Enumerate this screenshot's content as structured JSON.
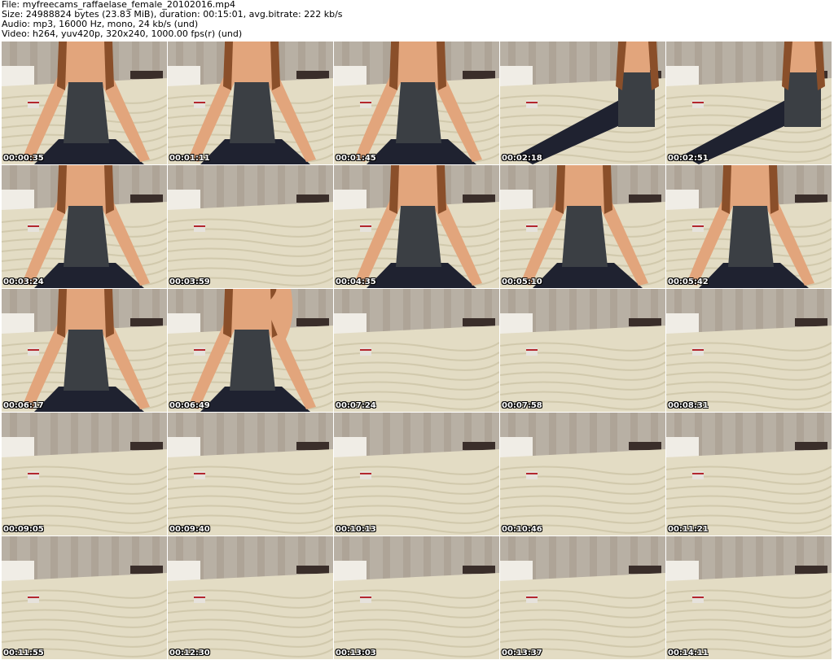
{
  "header": {
    "file_line": "File: myfreecams_raffaelase_female_20102016.mp4",
    "size_line": "Size: 24988824 bytes (23.83 MiB), duration: 00:15:01, avg.bitrate: 222 kb/s",
    "audio_line": "Audio: mp3, 16000 Hz, mono, 24 kb/s (und)",
    "video_line": "Video: h264, yuv420p, 320x240, 1000.00 fps(r) (und)"
  },
  "colors": {
    "wall": "#b8b0a4",
    "bedspread": "#e3dcc4",
    "bedspread_shadow": "#c9c0a3",
    "skin": "#e2a57c",
    "hair": "#8a4f2a",
    "top": "#3b3f44",
    "leggings": "#1f2230",
    "shelf": "#3a2e2a",
    "box": "#e6e2dc",
    "box_stripe": "#b3262e"
  },
  "thumbnails": [
    {
      "time": "00:00:35",
      "scene": "person-sitting"
    },
    {
      "time": "00:01:11",
      "scene": "person-sitting"
    },
    {
      "time": "00:01:45",
      "scene": "person-sitting"
    },
    {
      "time": "00:02:18",
      "scene": "person-reclining"
    },
    {
      "time": "00:02:51",
      "scene": "person-reclining"
    },
    {
      "time": "00:03:24",
      "scene": "person-sitting"
    },
    {
      "time": "00:03:59",
      "scene": "empty-bed"
    },
    {
      "time": "00:04:35",
      "scene": "person-sitting"
    },
    {
      "time": "00:05:10",
      "scene": "person-sitting"
    },
    {
      "time": "00:05:42",
      "scene": "person-sitting"
    },
    {
      "time": "00:06:17",
      "scene": "person-sitting"
    },
    {
      "time": "00:06:49",
      "scene": "person-on-phone"
    },
    {
      "time": "00:07:24",
      "scene": "empty-bed"
    },
    {
      "time": "00:07:58",
      "scene": "empty-bed"
    },
    {
      "time": "00:08:31",
      "scene": "empty-bed"
    },
    {
      "time": "00:09:05",
      "scene": "empty-bed"
    },
    {
      "time": "00:09:40",
      "scene": "empty-bed"
    },
    {
      "time": "00:10:13",
      "scene": "empty-bed"
    },
    {
      "time": "00:10:46",
      "scene": "empty-bed"
    },
    {
      "time": "00:11:21",
      "scene": "empty-bed"
    },
    {
      "time": "00:11:55",
      "scene": "empty-bed"
    },
    {
      "time": "00:12:30",
      "scene": "empty-bed"
    },
    {
      "time": "00:13:03",
      "scene": "empty-bed"
    },
    {
      "time": "00:13:37",
      "scene": "empty-bed"
    },
    {
      "time": "00:14:11",
      "scene": "empty-bed"
    }
  ]
}
